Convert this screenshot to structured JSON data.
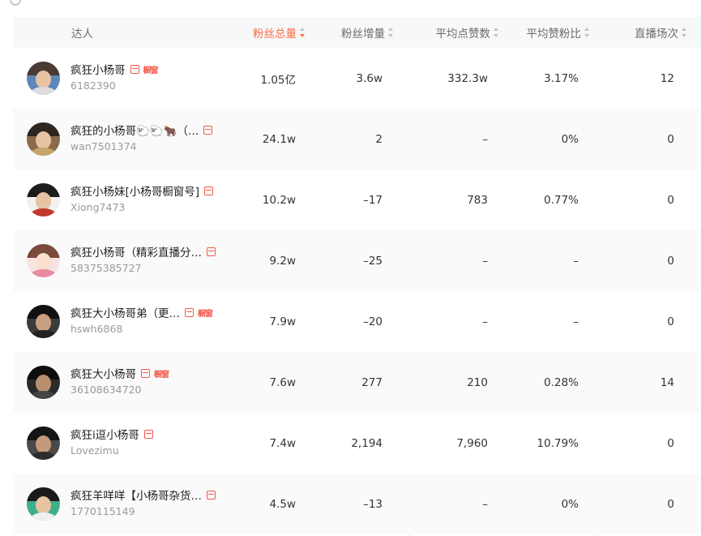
{
  "header": {
    "name": "达人",
    "fans_total": "粉丝总量",
    "fans_increase": "粉丝增量",
    "avg_likes": "平均点赞数",
    "like_fan_ratio": "平均赞粉比",
    "live_count": "直播场次"
  },
  "colors": {
    "accent": "#ff6a3d",
    "badge": "#f2594b"
  },
  "rows": [
    {
      "name": "疯狂小杨哥",
      "id": "6182390",
      "shop": "橱窗",
      "fans": "1.05亿",
      "increase": "3.6w",
      "likes": "332.3w",
      "ratio": "3.17%",
      "live": "12"
    },
    {
      "name": "疯狂的小杨哥🐑🐑🐂（…",
      "id": "wan7501374",
      "shop": "",
      "fans": "24.1w",
      "increase": "2",
      "likes": "–",
      "ratio": "0%",
      "live": "0"
    },
    {
      "name": "疯狂小杨妹[小杨哥橱窗号]",
      "id": "Xiong7473",
      "shop": "",
      "fans": "10.2w",
      "increase": "–17",
      "likes": "783",
      "ratio": "0.77%",
      "live": "0"
    },
    {
      "name": "疯狂小杨哥（精彩直播分…",
      "id": "58375385727",
      "shop": "",
      "fans": "9.2w",
      "increase": "–25",
      "likes": "–",
      "ratio": "–",
      "live": "0"
    },
    {
      "name": "疯狂大小杨哥弟（更…",
      "id": "hswh6868",
      "shop": "橱窗",
      "fans": "7.9w",
      "increase": "–20",
      "likes": "–",
      "ratio": "–",
      "live": "0"
    },
    {
      "name": "疯狂大小杨哥",
      "id": "36108634720",
      "shop": "橱窗",
      "fans": "7.6w",
      "increase": "277",
      "likes": "210",
      "ratio": "0.28%",
      "live": "14"
    },
    {
      "name": "疯狂i逗小杨哥",
      "id": "Lovezimu",
      "shop": "",
      "fans": "7.4w",
      "increase": "2,194",
      "likes": "7,960",
      "ratio": "10.79%",
      "live": "0"
    },
    {
      "name": "疯狂羊咩咩【小杨哥杂货…",
      "id": "1770115149",
      "shop": "",
      "fans": "4.5w",
      "increase": "–13",
      "likes": "–",
      "ratio": "0%",
      "live": "0"
    }
  ]
}
